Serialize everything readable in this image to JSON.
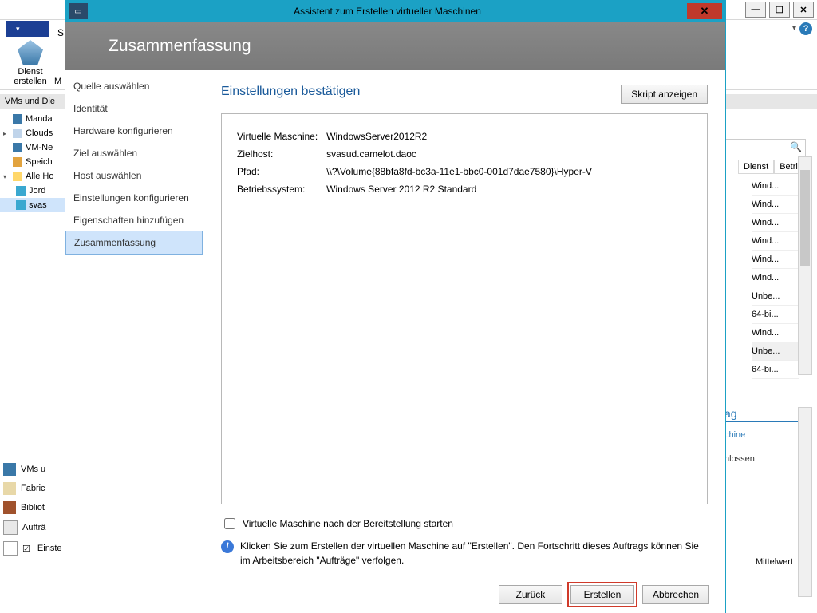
{
  "background": {
    "ribbon_label_line1": "Dienst",
    "ribbon_label_line2": "erstellen",
    "ribbon_M": "M",
    "ribbon_S": "S",
    "sub_header": "VMs und Die",
    "tree": [
      {
        "label": "Manda"
      },
      {
        "label": "Clouds"
      },
      {
        "label": "VM-Ne"
      },
      {
        "label": "Speich"
      },
      {
        "label": "Alle Ho"
      },
      {
        "label": "Jord"
      },
      {
        "label": "svas"
      }
    ],
    "views": {
      "vms": "VMs u",
      "fabric": "Fabric",
      "biblio": "Bibliot",
      "auftr": "Aufträ",
      "einste": "Einste"
    },
    "list_headers": {
      "dienst": "Dienst",
      "betri": "Betri..."
    },
    "list_rows": [
      "Wind...",
      "Wind...",
      "Wind...",
      "Wind...",
      "Wind...",
      "Wind...",
      "Unbe...",
      "64-bi...",
      "Wind...",
      "Unbe...",
      "64-bi..."
    ],
    "detail": {
      "hdr": "ag",
      "link": "chine",
      "txt": "hlossen",
      "mittel": "Mittelwert"
    }
  },
  "wizard": {
    "title": "Assistent zum Erstellen virtueller Maschinen",
    "banner": "Zusammenfassung",
    "steps": [
      "Quelle auswählen",
      "Identität",
      "Hardware konfigurieren",
      "Ziel auswählen",
      "Host auswählen",
      "Einstellungen konfigurieren",
      "Eigenschaften hinzufügen",
      "Zusammenfassung"
    ],
    "active_step_index": 7,
    "content_title": "Einstellungen bestätigen",
    "script_button": "Skript anzeigen",
    "summary": {
      "vm_label": "Virtuelle Maschine:",
      "vm_value": "WindowsServer2012R2",
      "host_label": "Zielhost:",
      "host_value": "svasud.camelot.daoc",
      "path_label": "Pfad:",
      "path_value": "\\\\?\\Volume{88bfa8fd-bc3a-11e1-bbc0-001d7dae7580}\\Hyper-V",
      "os_label": "Betriebssystem:",
      "os_value": "Windows Server 2012 R2 Standard"
    },
    "checkbox_label": "Virtuelle Maschine nach der Bereitstellung starten",
    "info_text": "Klicken Sie zum Erstellen der virtuellen Maschine auf \"Erstellen\".  Den Fortschritt dieses Auftrags können Sie im Arbeitsbereich \"Aufträge\" verfolgen.",
    "buttons": {
      "back": "Zurück",
      "create": "Erstellen",
      "cancel": "Abbrechen"
    }
  }
}
